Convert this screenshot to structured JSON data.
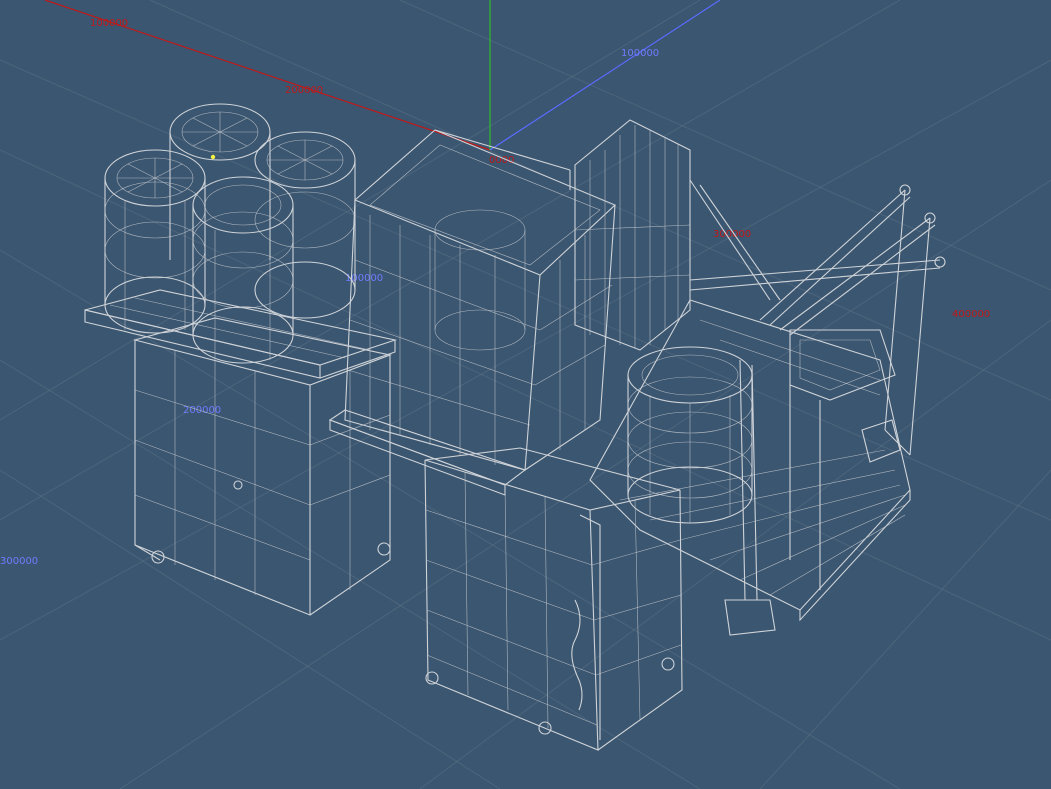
{
  "viewport": {
    "background": "#3b5670",
    "wire_color": "#cfd3d8",
    "axis_colors": {
      "x": "#c01818",
      "y": "#2fb82f",
      "z": "#5b6bff"
    }
  },
  "axis_labels": {
    "red_top_left": "100000",
    "red_upper": "200000",
    "red_center": "0000",
    "red_right_mid": "300000",
    "red_far_right": "400000",
    "blue_top": "100000",
    "blue_mid": "100000",
    "blue_lower": "200000",
    "blue_left": "300000"
  },
  "scene": {
    "objects": [
      "barrel-cluster",
      "container-cage-left",
      "central-frame",
      "filing-panels",
      "crane-arms",
      "barrel-single",
      "container-cage-front",
      "pallet-deck"
    ]
  }
}
